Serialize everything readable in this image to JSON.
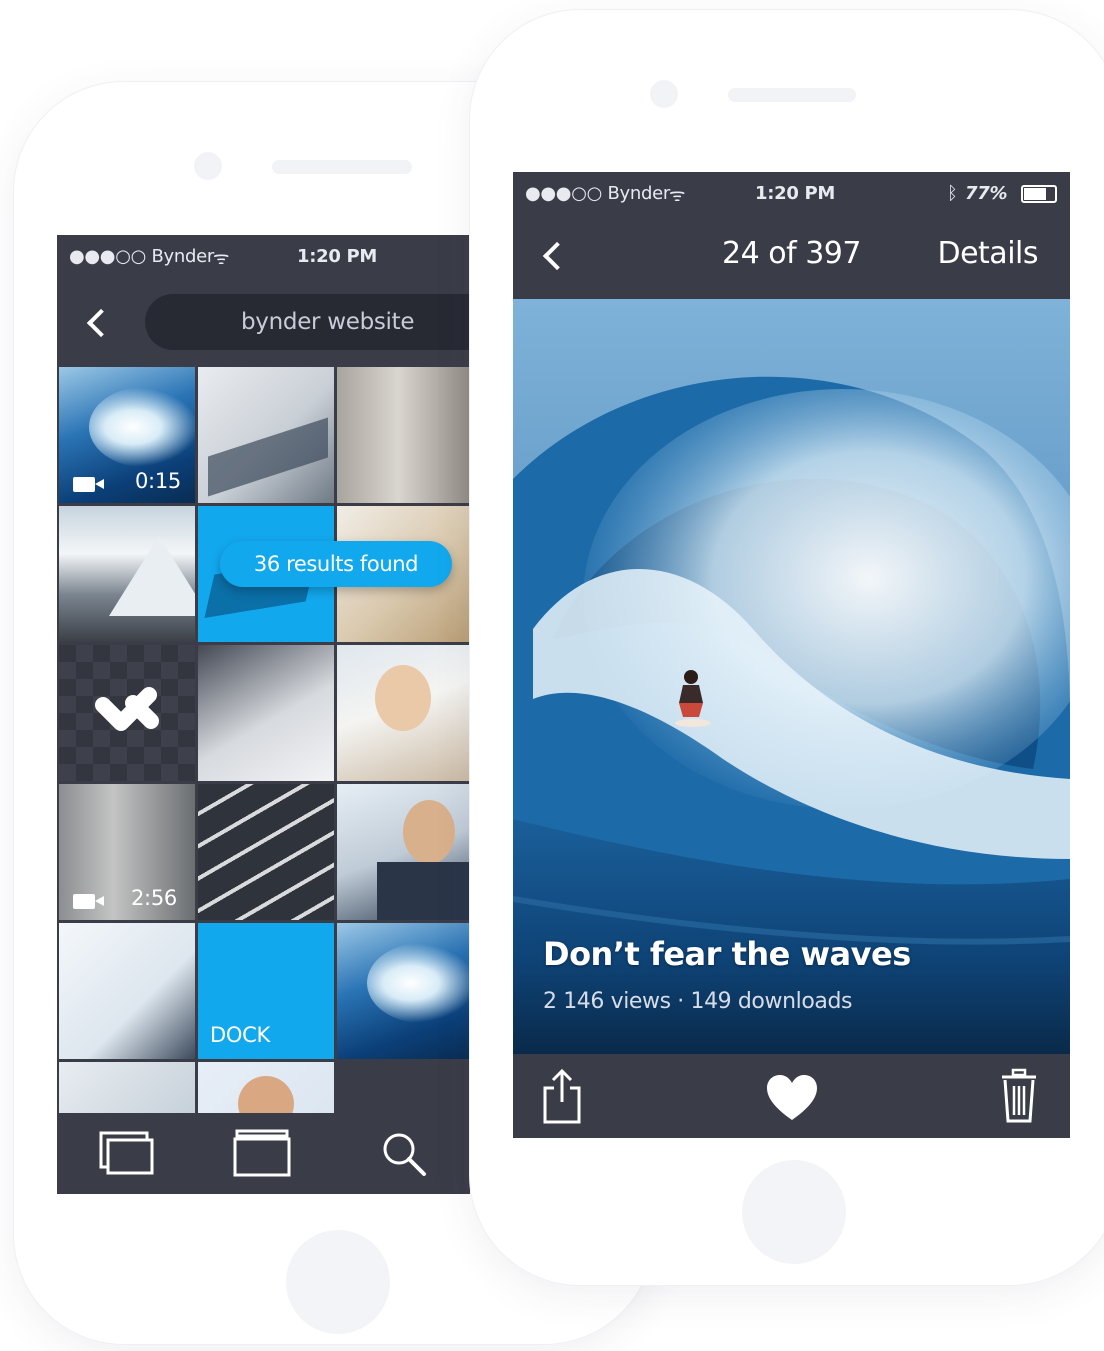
{
  "back_phone": {
    "status": {
      "carrier": "●●●○○ Bynder",
      "wifi": "ᯤ",
      "time": "1:20 PM"
    },
    "search": {
      "value": "bynder website"
    },
    "results_badge": "36 results found",
    "tiles": [
      {
        "duration": "0:15"
      },
      {
        "duration": "2:56"
      },
      {
        "label": "DOCK"
      }
    ],
    "tabbar": {
      "icons": [
        "collections-icon",
        "folder-icon",
        "search-icon"
      ]
    }
  },
  "front_phone": {
    "status": {
      "carrier": "●●●○○ Bynder",
      "wifi": "ᯤ",
      "time": "1:20 PM",
      "bluetooth": "ᛒ",
      "battery": "77%"
    },
    "nav": {
      "counter": "24 of 397",
      "details": "Details"
    },
    "asset": {
      "title": "Don’t fear the waves",
      "meta": "2 146 views · 149 downloads"
    },
    "actions": {
      "icons": [
        "share-icon",
        "heart-icon",
        "trash-icon"
      ]
    }
  },
  "colors": {
    "bar": "#3a3d48",
    "accent": "#12a8ee",
    "searchbox": "#272a33"
  }
}
